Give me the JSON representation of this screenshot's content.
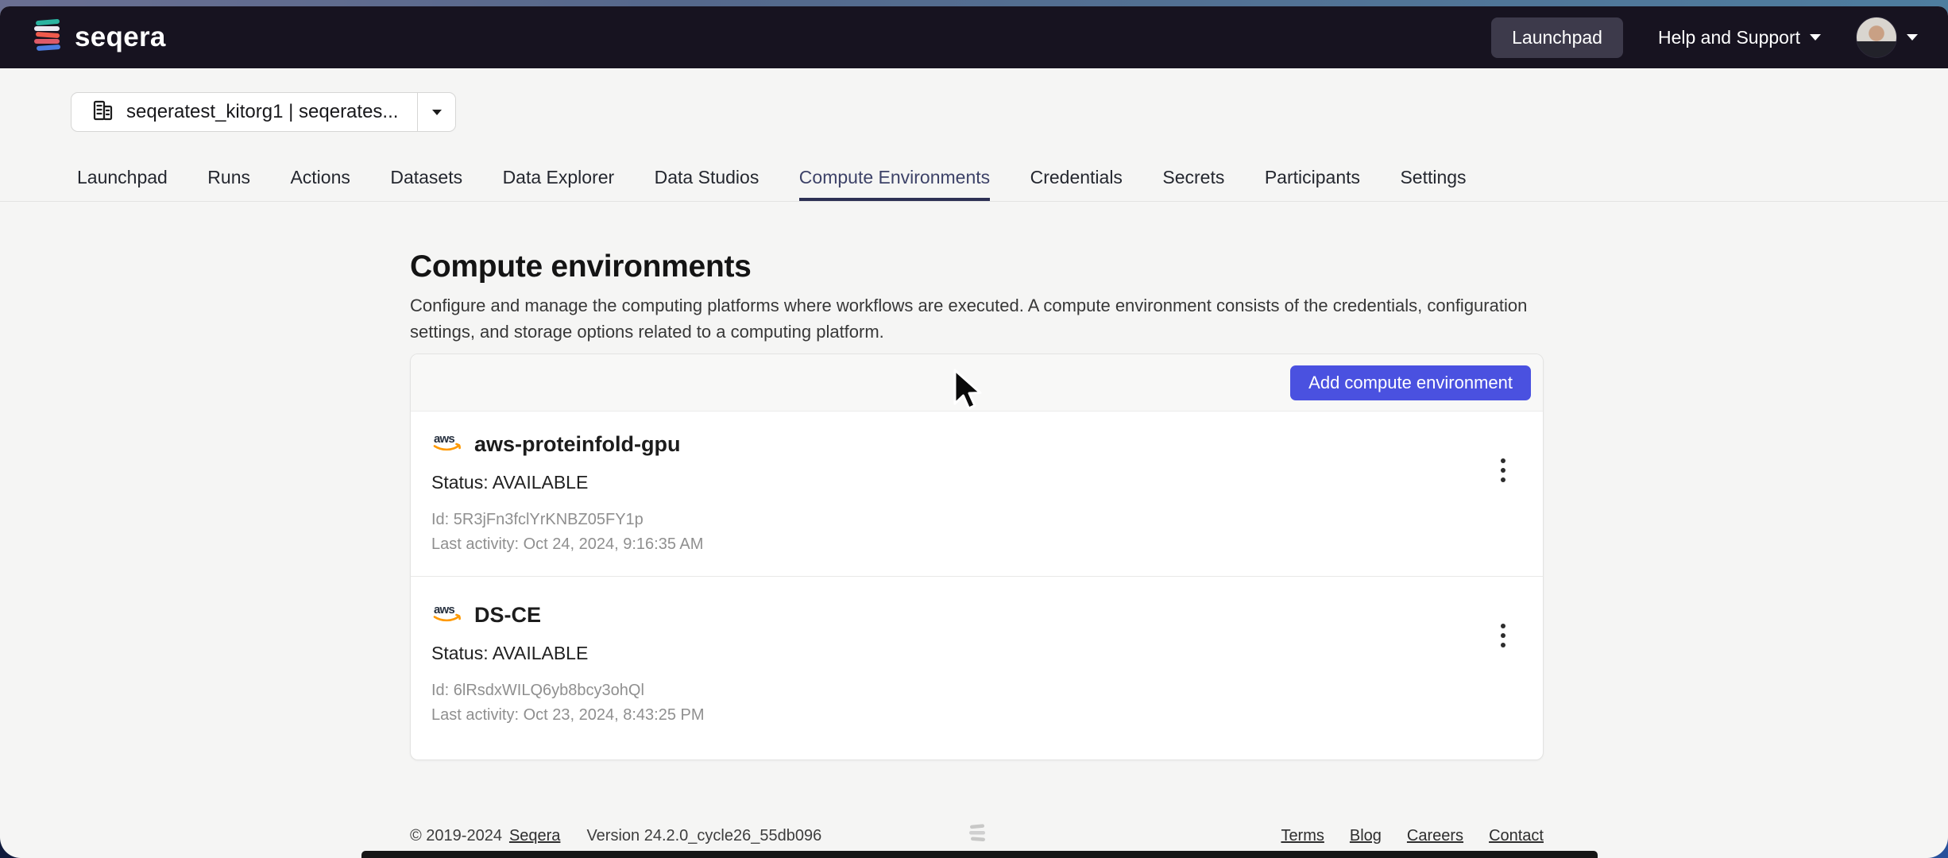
{
  "header": {
    "logo_text": "seqera",
    "launchpad_button": "Launchpad",
    "help_menu": "Help and Support"
  },
  "workspace_selector": {
    "label": "seqeratest_kitorg1 | seqerates..."
  },
  "tabs": {
    "items": [
      "Launchpad",
      "Runs",
      "Actions",
      "Datasets",
      "Data Explorer",
      "Data Studios",
      "Compute Environments",
      "Credentials",
      "Secrets",
      "Participants",
      "Settings"
    ],
    "active": "Compute Environments"
  },
  "page": {
    "title": "Compute environments",
    "description": "Configure and manage the computing platforms where workflows are executed. A compute environment consists of the credentials, configuration settings, and storage options related to a computing platform."
  },
  "toolbar": {
    "add_button": "Add compute environment"
  },
  "compute_environments": [
    {
      "provider_icon": "aws-icon",
      "name": "aws-proteinfold-gpu",
      "status": "Status: AVAILABLE",
      "id": "Id: 5R3jFn3fclYrKNBZ05FY1p",
      "last_activity": "Last activity: Oct 24, 2024, 9:16:35 AM"
    },
    {
      "provider_icon": "aws-icon",
      "name": "DS-CE",
      "status": "Status: AVAILABLE",
      "id": "Id: 6lRsdxWILQ6yb8bcy3ohQl",
      "last_activity": "Last activity: Oct 23, 2024, 8:43:25 PM"
    }
  ],
  "footer": {
    "copyright": "© 2019-2024",
    "company_link": "Seqera",
    "version": "Version 24.2.0_cycle26_55db096",
    "links": [
      "Terms",
      "Blog",
      "Careers",
      "Contact"
    ]
  },
  "colors": {
    "header_bg": "#171320",
    "accent_button": "#4a51e0",
    "active_tab_underline": "#2d3054",
    "aws_orange": "#ff9900"
  }
}
